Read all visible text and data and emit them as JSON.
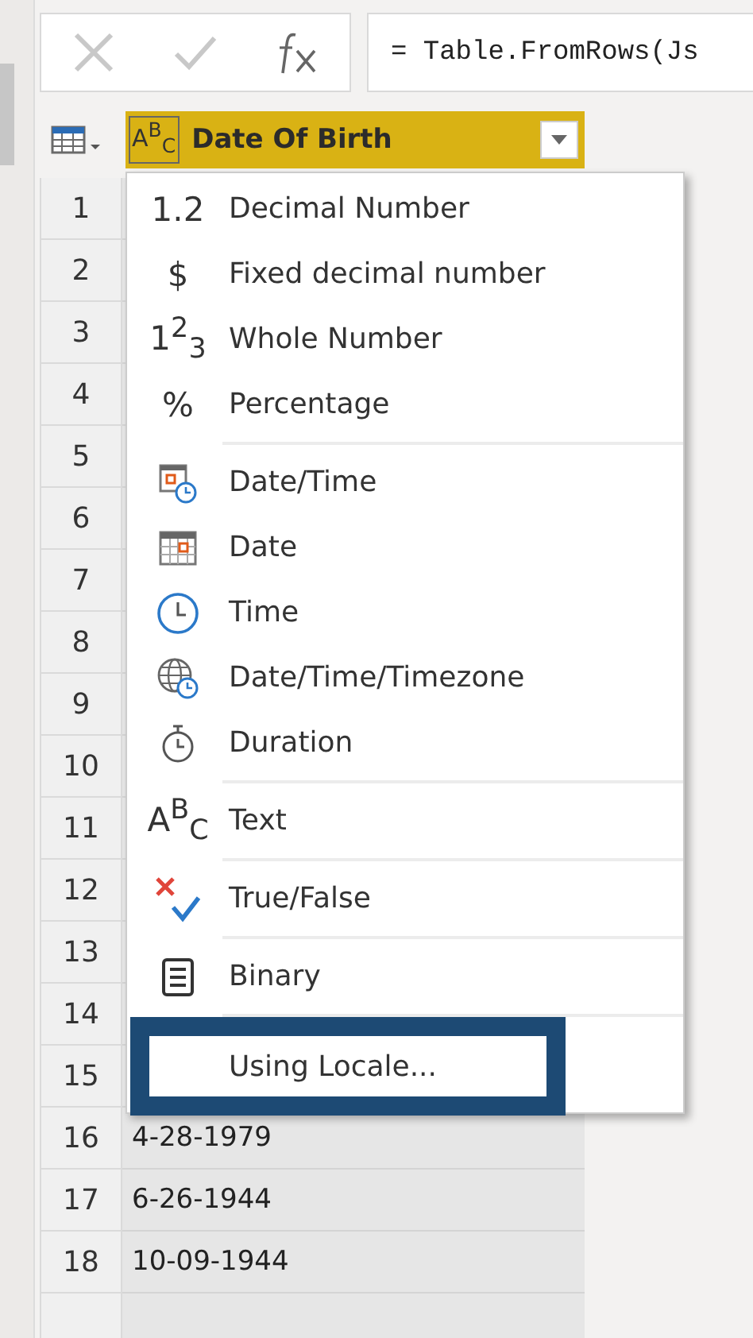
{
  "formula_bar": {
    "formula": "= Table.FromRows(Js"
  },
  "column_header": {
    "icon_text": "A$^{B}$$_{C}$",
    "title": "Date Of Birth"
  },
  "rows": [
    {
      "number": "1"
    },
    {
      "number": "2"
    },
    {
      "number": "3"
    },
    {
      "number": "4"
    },
    {
      "number": "5"
    },
    {
      "number": "6"
    },
    {
      "number": "7"
    },
    {
      "number": "8"
    },
    {
      "number": "9"
    },
    {
      "number": "10"
    },
    {
      "number": "11"
    },
    {
      "number": "12"
    },
    {
      "number": "13"
    },
    {
      "number": "14"
    },
    {
      "number": "15"
    },
    {
      "number": "16",
      "value": "4-28-1979"
    },
    {
      "number": "17",
      "value": "6-26-1944"
    },
    {
      "number": "18",
      "value": "10-09-1944"
    }
  ],
  "type_menu": {
    "groups": [
      [
        {
          "icon_text": "1.2",
          "label": "Decimal Number",
          "highlighted": false
        },
        {
          "icon_text": "$",
          "label": "Fixed decimal number",
          "highlighted": false
        },
        {
          "icon_text": "1$^{2}$$_{3}$",
          "label": "Whole Number",
          "highlighted": false
        },
        {
          "icon_text": "%",
          "label": "Percentage",
          "highlighted": false
        }
      ],
      [
        {
          "label": "Date/Time",
          "highlighted": false
        },
        {
          "label": "Date",
          "highlighted": false
        },
        {
          "label": "Time",
          "highlighted": false
        },
        {
          "label": "Date/Time/Timezone",
          "highlighted": false
        },
        {
          "label": "Duration",
          "highlighted": false
        }
      ],
      [
        {
          "icon_text": "A$^{B}$$_{C}$",
          "label": "Text",
          "highlighted": false
        }
      ],
      [
        {
          "label": "True/False",
          "highlighted": false
        }
      ],
      [
        {
          "label": "Binary",
          "highlighted": false
        }
      ],
      [
        {
          "label": "Using Locale...",
          "highlighted": true
        }
      ]
    ]
  }
}
